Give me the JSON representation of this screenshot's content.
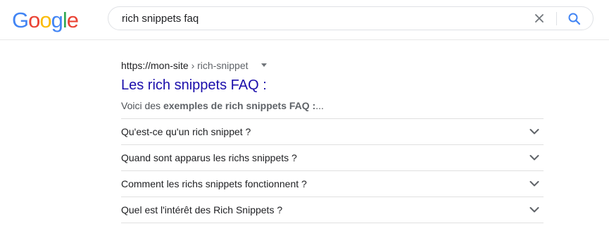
{
  "header": {
    "logo": "Google",
    "logo_letters": [
      {
        "char": "G",
        "color": "#4285F4"
      },
      {
        "char": "o",
        "color": "#EA4335"
      },
      {
        "char": "o",
        "color": "#FBBC05"
      },
      {
        "char": "g",
        "color": "#4285F4"
      },
      {
        "char": "l",
        "color": "#34A853"
      },
      {
        "char": "e",
        "color": "#EA4335"
      }
    ],
    "search_query": "rich snippets faq",
    "clear_icon": "close-icon",
    "search_icon": "search-icon"
  },
  "result": {
    "breadcrumb_domain": "https://mon-site",
    "breadcrumb_path": " › rich-snippet",
    "title": "Les rich snippets FAQ :",
    "snippet_prefix": "Voici des ",
    "snippet_bold": "exemples de rich snippets FAQ :",
    "snippet_suffix": "..."
  },
  "faq": [
    {
      "question": "Qu'est-ce qu'un rich snippet ?"
    },
    {
      "question": "Quand sont apparus les richs snippets ?"
    },
    {
      "question": "Comment les richs snippets fonctionnent ?"
    },
    {
      "question": "Quel est l'intérêt des Rich Snippets ?"
    }
  ],
  "colors": {
    "link": "#1a0dab",
    "text": "#202124",
    "muted": "#5f6368",
    "search_blue": "#4285F4"
  }
}
